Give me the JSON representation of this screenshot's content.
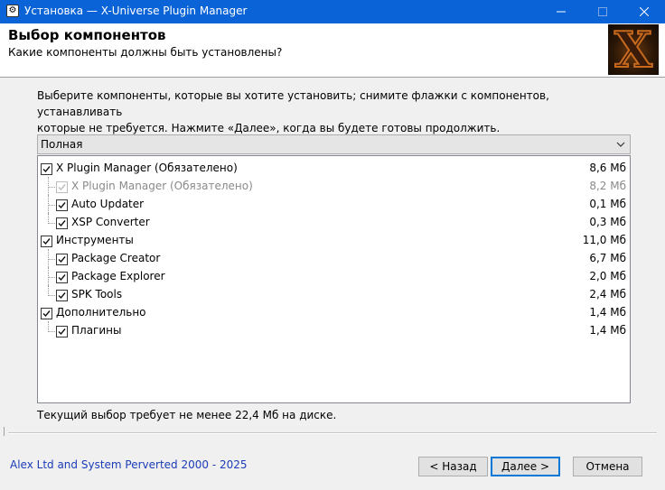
{
  "window": {
    "title": "Установка — X-Universe Plugin Manager",
    "app_icon_glyph": "⚙"
  },
  "header": {
    "title": "Выбор компонентов",
    "subtitle": "Какие компоненты должны быть установлены?",
    "logo_letter": "X"
  },
  "intro": {
    "line1": "Выберите компоненты, которые вы хотите установить; снимите флажки с компонентов, устанавливать",
    "line2": "которые не требуется. Нажмите «Далее», когда вы будете готовы продолжить."
  },
  "install_type": {
    "selected": "Полная"
  },
  "components": [
    {
      "label": "X Plugin Manager (Обязателено)",
      "size": "8,6 Мб",
      "level": 0,
      "checked": true,
      "disabled": false
    },
    {
      "label": "X Plugin Manager (Обязателено)",
      "size": "8,2 Мб",
      "level": 1,
      "checked": true,
      "disabled": true
    },
    {
      "label": "Auto Updater",
      "size": "0,1 Мб",
      "level": 1,
      "checked": true,
      "disabled": false
    },
    {
      "label": "XSP Converter",
      "size": "0,3 Мб",
      "level": 1,
      "checked": true,
      "disabled": false
    },
    {
      "label": "Инструменты",
      "size": "11,0 Мб",
      "level": 0,
      "checked": true,
      "disabled": false
    },
    {
      "label": "Package Creator",
      "size": "6,7 Мб",
      "level": 1,
      "checked": true,
      "disabled": false
    },
    {
      "label": "Package Explorer",
      "size": "2,0 Мб",
      "level": 1,
      "checked": true,
      "disabled": false
    },
    {
      "label": "SPK Tools",
      "size": "2,4 Мб",
      "level": 1,
      "checked": true,
      "disabled": false
    },
    {
      "label": "Дополнительно",
      "size": "1,4 Мб",
      "level": 0,
      "checked": true,
      "disabled": false
    },
    {
      "label": "Плагины",
      "size": "1,4 Мб",
      "level": 1,
      "checked": true,
      "disabled": false
    }
  ],
  "space_required": "Текущий выбор требует не менее 22,4 Мб на диске.",
  "footer": {
    "copyright": "Alex Ltd and System Perverted 2000 - 2025",
    "back_label": "< Назад",
    "next_label": "Далее >",
    "cancel_label": "Отмена"
  },
  "colors": {
    "titlebar": "#0a64d8",
    "link": "#1a3cb8",
    "default_button_border": "#0078d7"
  }
}
